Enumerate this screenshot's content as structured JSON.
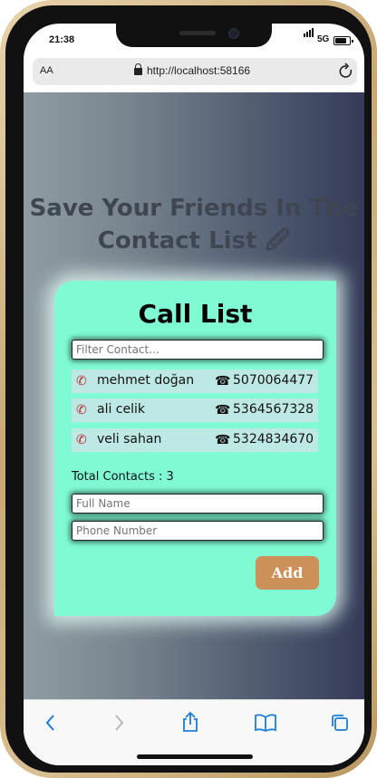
{
  "status": {
    "time": "21:38",
    "network": "5G"
  },
  "browser": {
    "aa_label": "AA",
    "url": "http://localhost:58166"
  },
  "page": {
    "heading": "Save Your Friends In The Contact List 🖉"
  },
  "card": {
    "title": "Call List",
    "filter_placeholder": "Filter Contact...",
    "contacts": [
      {
        "name": "mehmet doğan",
        "phone": "5070064477"
      },
      {
        "name": "ali celik",
        "phone": "5364567328"
      },
      {
        "name": "veli sahan",
        "phone": "5324834670"
      }
    ],
    "total_label": "Total Contacts : 3",
    "fullname_placeholder": "Full Name",
    "phone_placeholder": "Phone Number",
    "add_label": "Add"
  },
  "icons": {
    "contact_icon": "phone-receiver-icon",
    "number_icon": "telephone-icon"
  },
  "colors": {
    "card_bg": "#7ffad4",
    "row_bg": "#bde8e3",
    "add_button": "#cc9058",
    "ios_blue": "#1a7ed6"
  }
}
